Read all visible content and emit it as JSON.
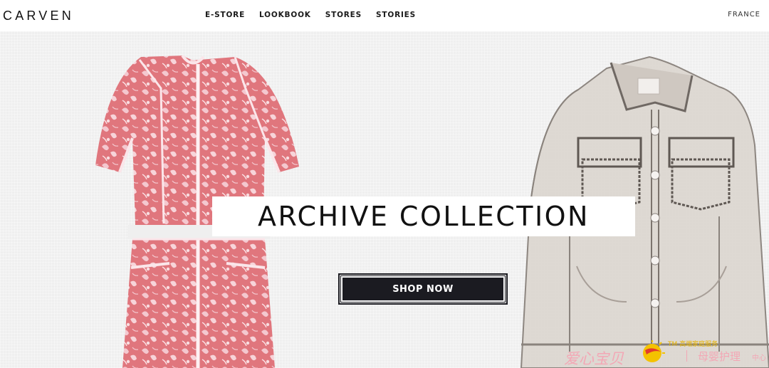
{
  "header": {
    "logo": "CARVEN",
    "nav": [
      {
        "label": "E-STORE"
      },
      {
        "label": "LOOKBOOK"
      },
      {
        "label": "STORES"
      },
      {
        "label": "STORIES"
      }
    ],
    "region": "FRANCE"
  },
  "hero": {
    "headline": "ARCHIVE COLLECTION",
    "cta": "SHOP NOW",
    "left_image": "pink-floral-dress",
    "right_image": "clear-vinyl-jacket"
  },
  "watermark": {
    "brand": "爱心宝贝",
    "tm": "TM 高端家庭服务",
    "sub": "母婴护理",
    "sub_small": "中心",
    "icon": "sun-logo-icon"
  },
  "colors": {
    "dress_base": "#e0767d",
    "dress_floral": "#f4c8cf",
    "jacket_base": "#c9c2bc",
    "cta_bg": "#1b1b21",
    "watermark_pink": "#f3a7b5"
  }
}
